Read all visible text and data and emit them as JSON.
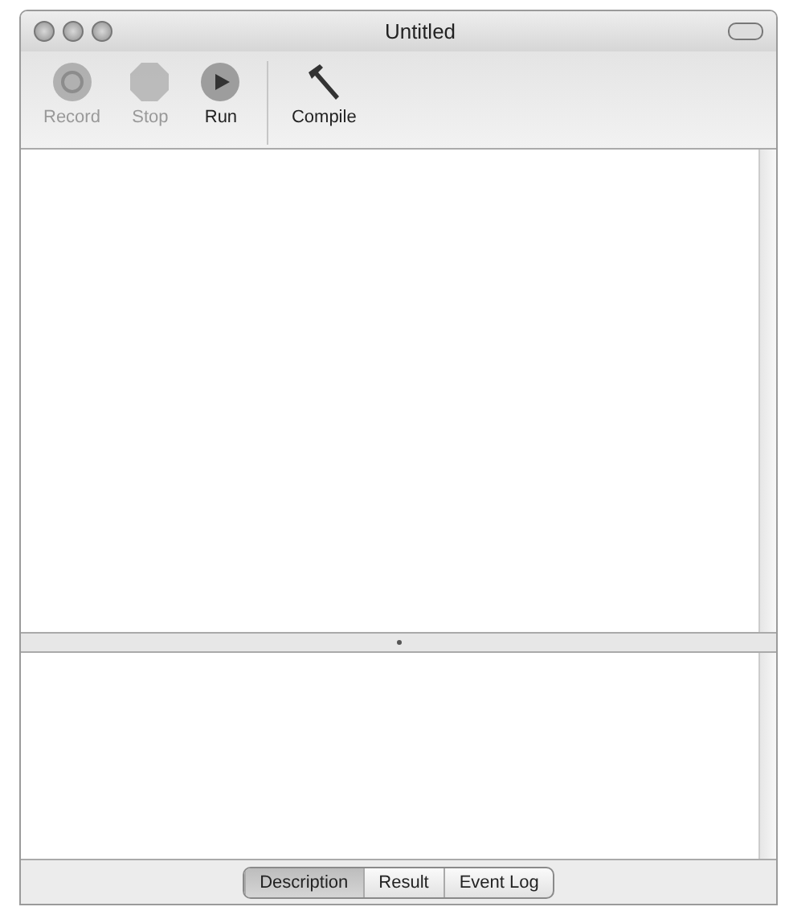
{
  "window": {
    "title": "Untitled"
  },
  "toolbar": [
    {
      "label": "Record",
      "kind": "record",
      "disabled": true
    },
    {
      "label": "Stop",
      "kind": "stop",
      "disabled": true
    },
    {
      "label": "Run",
      "kind": "run",
      "disabled": false
    },
    {
      "label": "Compile",
      "kind": "compile",
      "disabled": false
    }
  ],
  "tabs": [
    {
      "label": "Description",
      "selected": true
    },
    {
      "label": "Result",
      "selected": false
    },
    {
      "label": "Event Log",
      "selected": false
    }
  ]
}
